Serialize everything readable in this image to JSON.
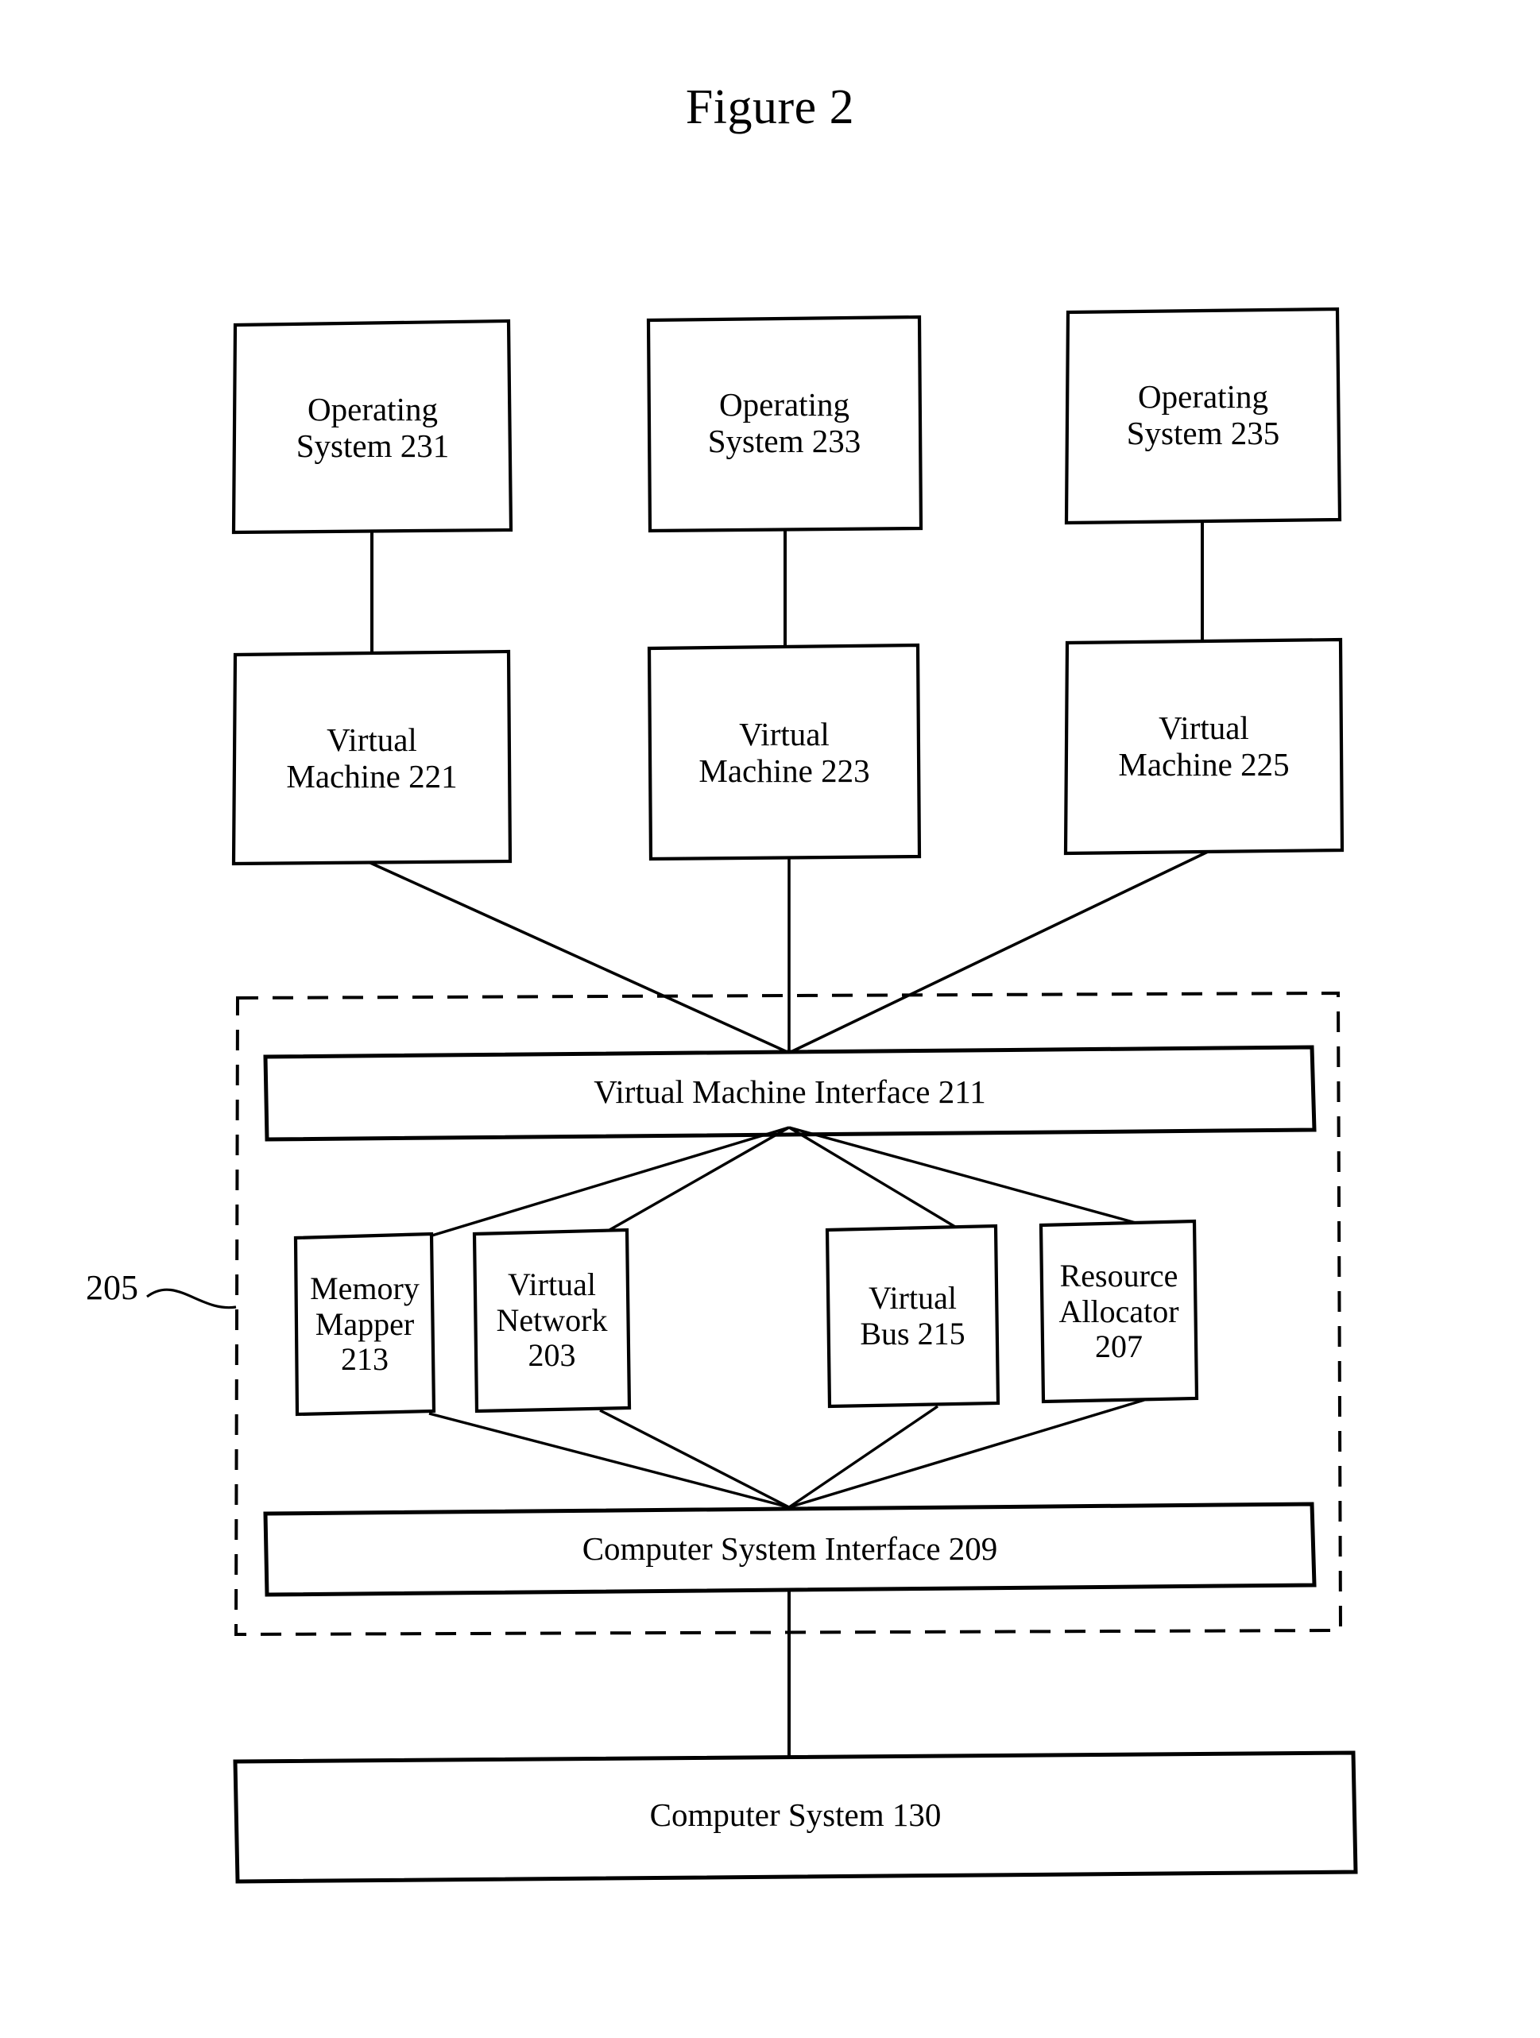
{
  "figure": {
    "title": "Figure 2"
  },
  "reference_numerals": {
    "boundary_label": "205"
  },
  "nodes": {
    "operating_systems": [
      {
        "id": "os-231",
        "label": "Operating\nSystem 231"
      },
      {
        "id": "os-233",
        "label": "Operating\nSystem 233"
      },
      {
        "id": "os-235",
        "label": "Operating\nSystem 235"
      }
    ],
    "virtual_machines": [
      {
        "id": "vm-221",
        "label": "Virtual\nMachine 221"
      },
      {
        "id": "vm-223",
        "label": "Virtual\nMachine 223"
      },
      {
        "id": "vm-225",
        "label": "Virtual\nMachine 225"
      }
    ],
    "virtual_machine_interface": {
      "id": "vmi-211",
      "label": "Virtual Machine Interface 211"
    },
    "components": [
      {
        "id": "memory-mapper-213",
        "label": "Memory\nMapper\n213"
      },
      {
        "id": "virtual-network-203",
        "label": "Virtual\nNetwork\n203"
      },
      {
        "id": "virtual-bus-215",
        "label": "Virtual\nBus 215"
      },
      {
        "id": "resource-allocator-207",
        "label": "Resource\nAllocator\n207"
      }
    ],
    "computer_system_interface": {
      "id": "csi-209",
      "label": "Computer System Interface 209"
    },
    "computer_system": {
      "id": "cs-130",
      "label": "Computer System 130"
    }
  },
  "colors": {
    "ink": "#000000",
    "paper": "#ffffff"
  }
}
